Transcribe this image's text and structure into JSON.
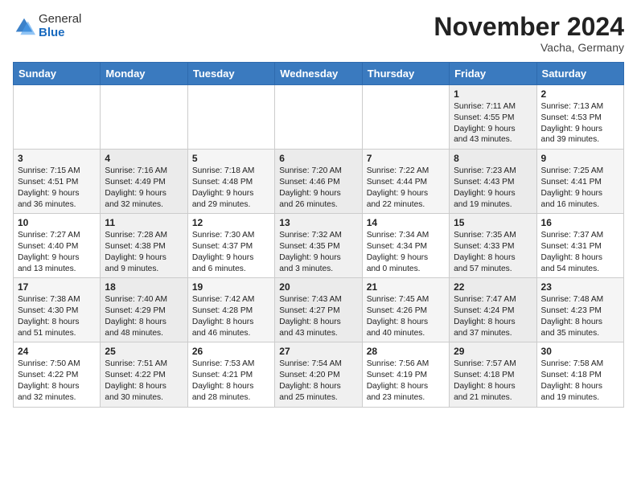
{
  "header": {
    "logo_general": "General",
    "logo_blue": "Blue",
    "title": "November 2024",
    "location": "Vacha, Germany"
  },
  "weekdays": [
    "Sunday",
    "Monday",
    "Tuesday",
    "Wednesday",
    "Thursday",
    "Friday",
    "Saturday"
  ],
  "weeks": [
    [
      {
        "day": "",
        "info": ""
      },
      {
        "day": "",
        "info": ""
      },
      {
        "day": "",
        "info": ""
      },
      {
        "day": "",
        "info": ""
      },
      {
        "day": "",
        "info": ""
      },
      {
        "day": "1",
        "info": "Sunrise: 7:11 AM\nSunset: 4:55 PM\nDaylight: 9 hours\nand 43 minutes."
      },
      {
        "day": "2",
        "info": "Sunrise: 7:13 AM\nSunset: 4:53 PM\nDaylight: 9 hours\nand 39 minutes."
      }
    ],
    [
      {
        "day": "3",
        "info": "Sunrise: 7:15 AM\nSunset: 4:51 PM\nDaylight: 9 hours\nand 36 minutes."
      },
      {
        "day": "4",
        "info": "Sunrise: 7:16 AM\nSunset: 4:49 PM\nDaylight: 9 hours\nand 32 minutes."
      },
      {
        "day": "5",
        "info": "Sunrise: 7:18 AM\nSunset: 4:48 PM\nDaylight: 9 hours\nand 29 minutes."
      },
      {
        "day": "6",
        "info": "Sunrise: 7:20 AM\nSunset: 4:46 PM\nDaylight: 9 hours\nand 26 minutes."
      },
      {
        "day": "7",
        "info": "Sunrise: 7:22 AM\nSunset: 4:44 PM\nDaylight: 9 hours\nand 22 minutes."
      },
      {
        "day": "8",
        "info": "Sunrise: 7:23 AM\nSunset: 4:43 PM\nDaylight: 9 hours\nand 19 minutes."
      },
      {
        "day": "9",
        "info": "Sunrise: 7:25 AM\nSunset: 4:41 PM\nDaylight: 9 hours\nand 16 minutes."
      }
    ],
    [
      {
        "day": "10",
        "info": "Sunrise: 7:27 AM\nSunset: 4:40 PM\nDaylight: 9 hours\nand 13 minutes."
      },
      {
        "day": "11",
        "info": "Sunrise: 7:28 AM\nSunset: 4:38 PM\nDaylight: 9 hours\nand 9 minutes."
      },
      {
        "day": "12",
        "info": "Sunrise: 7:30 AM\nSunset: 4:37 PM\nDaylight: 9 hours\nand 6 minutes."
      },
      {
        "day": "13",
        "info": "Sunrise: 7:32 AM\nSunset: 4:35 PM\nDaylight: 9 hours\nand 3 minutes."
      },
      {
        "day": "14",
        "info": "Sunrise: 7:34 AM\nSunset: 4:34 PM\nDaylight: 9 hours\nand 0 minutes."
      },
      {
        "day": "15",
        "info": "Sunrise: 7:35 AM\nSunset: 4:33 PM\nDaylight: 8 hours\nand 57 minutes."
      },
      {
        "day": "16",
        "info": "Sunrise: 7:37 AM\nSunset: 4:31 PM\nDaylight: 8 hours\nand 54 minutes."
      }
    ],
    [
      {
        "day": "17",
        "info": "Sunrise: 7:38 AM\nSunset: 4:30 PM\nDaylight: 8 hours\nand 51 minutes."
      },
      {
        "day": "18",
        "info": "Sunrise: 7:40 AM\nSunset: 4:29 PM\nDaylight: 8 hours\nand 48 minutes."
      },
      {
        "day": "19",
        "info": "Sunrise: 7:42 AM\nSunset: 4:28 PM\nDaylight: 8 hours\nand 46 minutes."
      },
      {
        "day": "20",
        "info": "Sunrise: 7:43 AM\nSunset: 4:27 PM\nDaylight: 8 hours\nand 43 minutes."
      },
      {
        "day": "21",
        "info": "Sunrise: 7:45 AM\nSunset: 4:26 PM\nDaylight: 8 hours\nand 40 minutes."
      },
      {
        "day": "22",
        "info": "Sunrise: 7:47 AM\nSunset: 4:24 PM\nDaylight: 8 hours\nand 37 minutes."
      },
      {
        "day": "23",
        "info": "Sunrise: 7:48 AM\nSunset: 4:23 PM\nDaylight: 8 hours\nand 35 minutes."
      }
    ],
    [
      {
        "day": "24",
        "info": "Sunrise: 7:50 AM\nSunset: 4:22 PM\nDaylight: 8 hours\nand 32 minutes."
      },
      {
        "day": "25",
        "info": "Sunrise: 7:51 AM\nSunset: 4:22 PM\nDaylight: 8 hours\nand 30 minutes."
      },
      {
        "day": "26",
        "info": "Sunrise: 7:53 AM\nSunset: 4:21 PM\nDaylight: 8 hours\nand 28 minutes."
      },
      {
        "day": "27",
        "info": "Sunrise: 7:54 AM\nSunset: 4:20 PM\nDaylight: 8 hours\nand 25 minutes."
      },
      {
        "day": "28",
        "info": "Sunrise: 7:56 AM\nSunset: 4:19 PM\nDaylight: 8 hours\nand 23 minutes."
      },
      {
        "day": "29",
        "info": "Sunrise: 7:57 AM\nSunset: 4:18 PM\nDaylight: 8 hours\nand 21 minutes."
      },
      {
        "day": "30",
        "info": "Sunrise: 7:58 AM\nSunset: 4:18 PM\nDaylight: 8 hours\nand 19 minutes."
      }
    ]
  ]
}
